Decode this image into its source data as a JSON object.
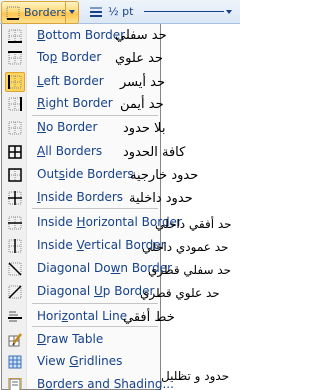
{
  "ribbon": {
    "borders_button": "Borders",
    "line_weight": "½ pt"
  },
  "menu": {
    "items": [
      {
        "pre": "",
        "key": "B",
        "post": "ottom Border",
        "annotation": "حد سفلي",
        "icon": "bottom-border-icon"
      },
      {
        "pre": "To",
        "key": "p",
        "post": " Border",
        "annotation": "حد علوي",
        "icon": "top-border-icon"
      },
      {
        "pre": "",
        "key": "L",
        "post": "eft Border",
        "annotation": "حد أيسر",
        "icon": "left-border-icon",
        "selected": true
      },
      {
        "pre": "",
        "key": "R",
        "post": "ight Border",
        "annotation": "حد أيمن",
        "icon": "right-border-icon"
      },
      {
        "pre": "",
        "key": "N",
        "post": "o Border",
        "annotation": "بلا حدود",
        "icon": "no-border-icon"
      },
      {
        "pre": "",
        "key": "A",
        "post": "ll Borders",
        "annotation": "كافة الحدود",
        "icon": "all-borders-icon"
      },
      {
        "pre": "Out",
        "key": "s",
        "post": "ide Borders",
        "annotation": "حدود خارجية",
        "icon": "outside-borders-icon"
      },
      {
        "pre": "",
        "key": "I",
        "post": "nside Borders",
        "annotation": "حدود داخلية",
        "icon": "inside-borders-icon"
      },
      {
        "pre": "Inside ",
        "key": "H",
        "post": "orizontal Border",
        "annotation": "حد أفقي داخلي",
        "icon": "inside-horizontal-border-icon"
      },
      {
        "pre": "Inside ",
        "key": "V",
        "post": "ertical Border",
        "annotation": "حد عمودي داخلي",
        "icon": "inside-vertical-border-icon"
      },
      {
        "pre": "Diagonal Do",
        "key": "w",
        "post": "n Border",
        "annotation": "حد سفلي قطري",
        "icon": "diagonal-down-border-icon"
      },
      {
        "pre": "Diagonal ",
        "key": "U",
        "post": "p Border",
        "annotation": "حد علوي قطري",
        "icon": "diagonal-up-border-icon"
      },
      {
        "pre": "Hori",
        "key": "z",
        "post": "ontal Line",
        "annotation": "خط أفقي",
        "icon": "horizontal-line-icon"
      },
      {
        "pre": "",
        "key": "D",
        "post": "raw Table",
        "annotation": "",
        "icon": "draw-table-icon"
      },
      {
        "pre": "View ",
        "key": "G",
        "post": "ridlines",
        "annotation": "",
        "icon": "view-gridlines-icon"
      },
      {
        "pre": "B",
        "key": "o",
        "post": "rders and Shading...",
        "annotation": "حدود و تظليل",
        "icon": "borders-and-shading-icon"
      }
    ]
  }
}
